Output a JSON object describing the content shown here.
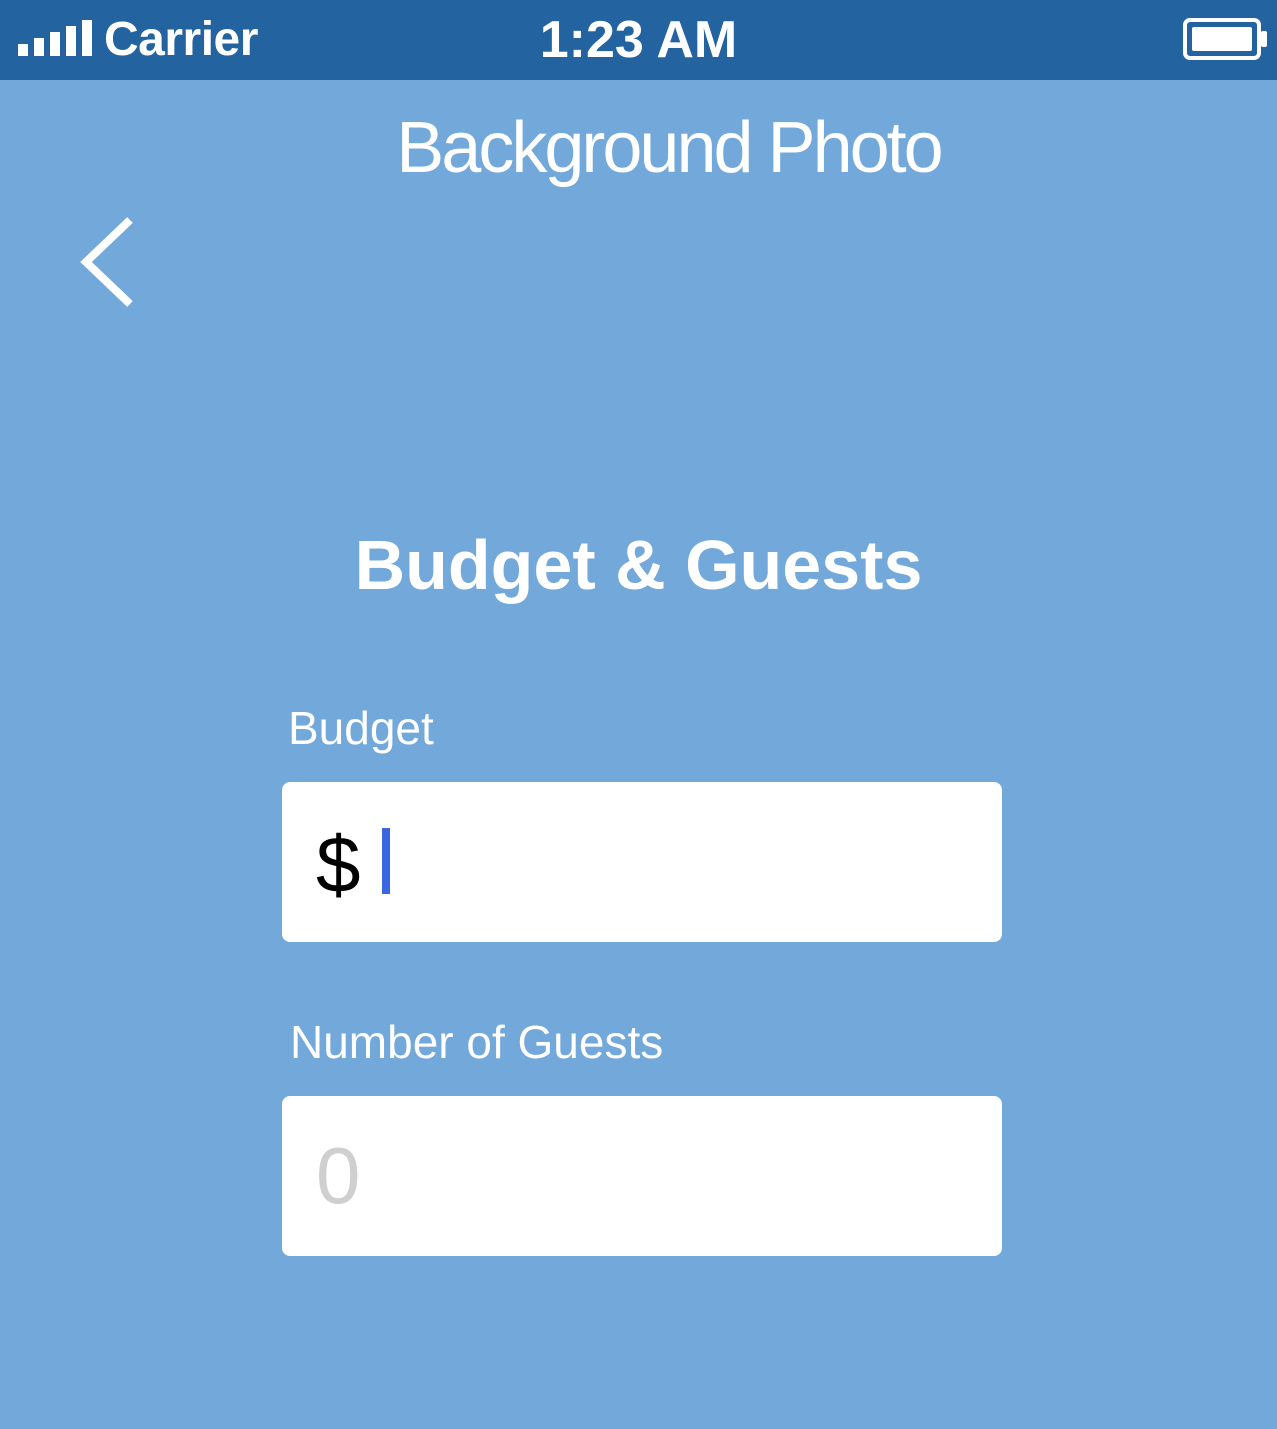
{
  "status_bar": {
    "carrier": "Carrier",
    "time": "1:23 AM",
    "signal_icon": "signal-bars-icon",
    "battery_icon": "battery-full-icon",
    "background_color": "#2263a0"
  },
  "header": {
    "background_photo_label": "Background Photo",
    "back_icon": "chevron-left-icon"
  },
  "screen": {
    "title": "Budget & Guests",
    "background_color": "#73a8da"
  },
  "form": {
    "budget": {
      "label": "Budget",
      "currency_symbol": "$",
      "value": "",
      "focused": true
    },
    "guests": {
      "label": "Number of Guests",
      "value": "",
      "placeholder": "0"
    }
  },
  "colors": {
    "caret": "#3b66e2",
    "placeholder": "#cfcfcf"
  }
}
